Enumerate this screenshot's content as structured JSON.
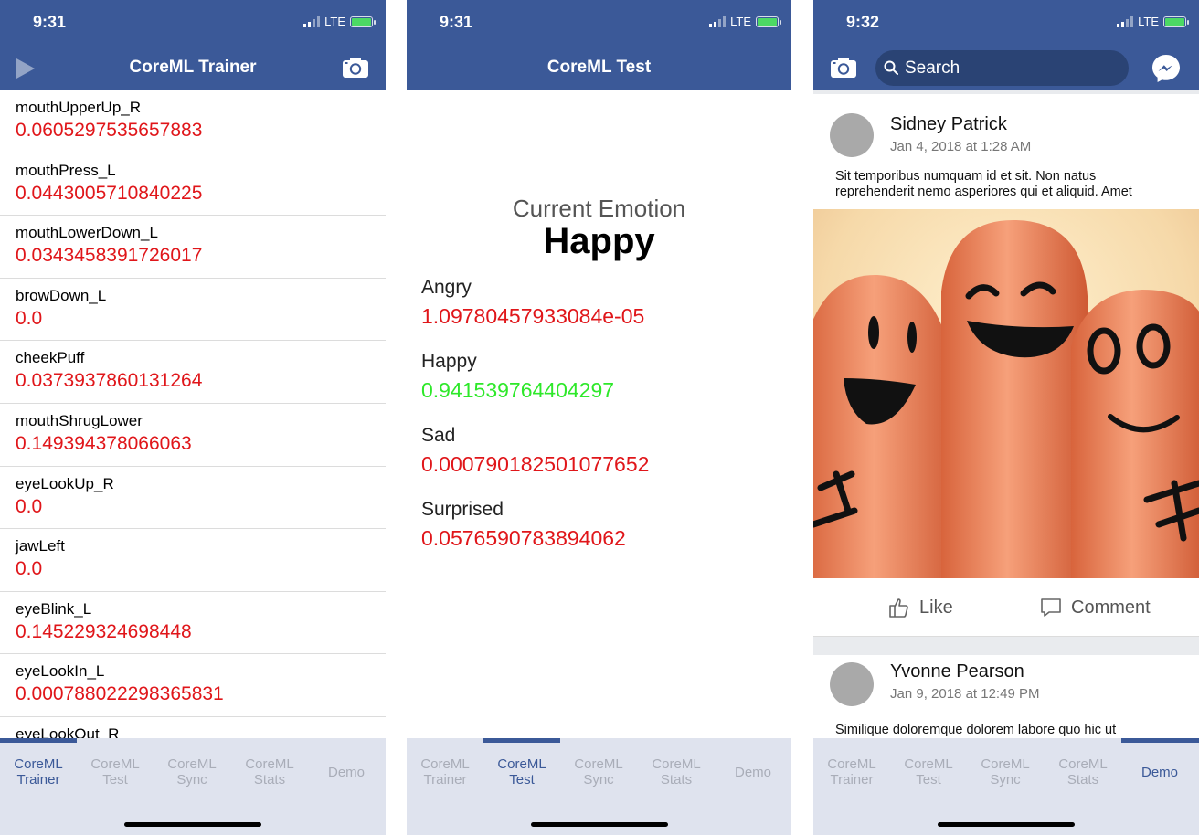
{
  "status": {
    "time_1": "9:31",
    "time_2": "9:31",
    "time_3": "9:32",
    "network": "LTE"
  },
  "trainer": {
    "title": "CoreML Trainer",
    "rows": [
      {
        "key": "mouthUpperUp_R",
        "value": "0.0605297535657883"
      },
      {
        "key": "mouthPress_L",
        "value": "0.0443005710840225"
      },
      {
        "key": "mouthLowerDown_L",
        "value": "0.0343458391726017"
      },
      {
        "key": "browDown_L",
        "value": "0.0"
      },
      {
        "key": "cheekPuff",
        "value": "0.0373937860131264"
      },
      {
        "key": "mouthShrugLower",
        "value": "0.149394378066063"
      },
      {
        "key": "eyeLookUp_R",
        "value": "0.0"
      },
      {
        "key": "jawLeft",
        "value": "0.0"
      },
      {
        "key": "eyeBlink_L",
        "value": "0.145229324698448"
      },
      {
        "key": "eyeLookIn_L",
        "value": "0.000788022298365831"
      },
      {
        "key": "eyeLookOut_R",
        "value": ""
      }
    ]
  },
  "test": {
    "title": "CoreML Test",
    "current_label": "Current Emotion",
    "current_value": "Happy",
    "emotions": [
      {
        "name": "Angry",
        "value": "1.09780457933084e-05",
        "color": "#e0161a"
      },
      {
        "name": "Happy",
        "value": "0.941539764404297",
        "color": "#2ee82a"
      },
      {
        "name": "Sad",
        "value": "0.000790182501077652",
        "color": "#e0161a"
      },
      {
        "name": "Surprised",
        "value": "0.0576590783894062",
        "color": "#e0161a"
      }
    ]
  },
  "demo": {
    "search_placeholder": "Search",
    "posts": [
      {
        "name": "Sidney Patrick",
        "date": "Jan 4, 2018 at 1:28 AM",
        "text": "Sit temporibus numquam id et sit. Non natus reprehenderit nemo asperiores qui et aliquid. Amet"
      },
      {
        "name": "Yvonne Pearson",
        "date": "Jan 9, 2018 at 12:49 PM",
        "text": "Similique doloremque dolorem labore quo hic ut"
      }
    ],
    "like_label": "Like",
    "comment_label": "Comment"
  },
  "tabs": [
    {
      "line1": "CoreML",
      "line2": "Trainer"
    },
    {
      "line1": "CoreML",
      "line2": "Test"
    },
    {
      "line1": "CoreML",
      "line2": "Sync"
    },
    {
      "line1": "CoreML",
      "line2": "Stats"
    },
    {
      "line1": "Demo",
      "line2": ""
    }
  ],
  "colors": {
    "brand": "#3b5998",
    "value_red": "#e0161a",
    "value_green": "#2ee82a",
    "tabbar_bg": "#dfe3ee"
  }
}
